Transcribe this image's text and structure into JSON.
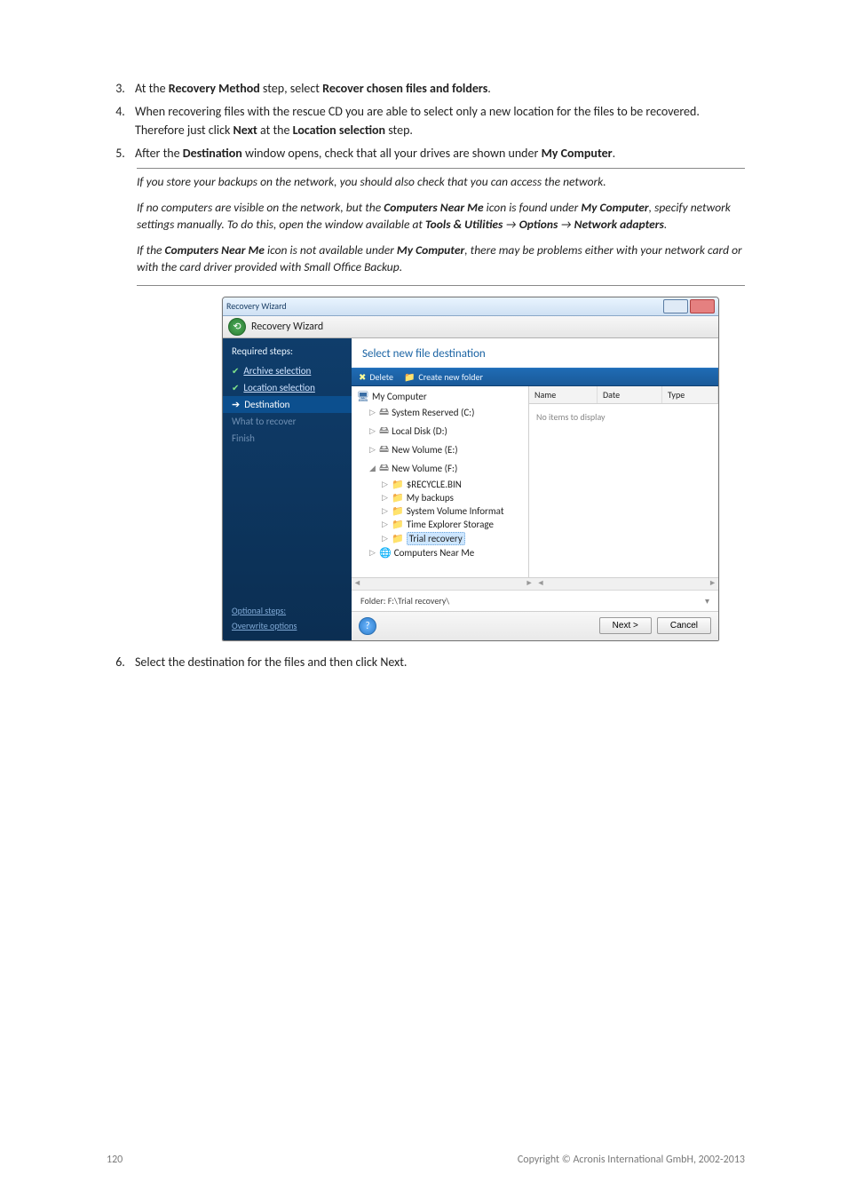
{
  "list": {
    "i3": {
      "pre": "At the ",
      "b1": "Recovery Method",
      "mid": " step, select ",
      "b2": "Recover chosen files and folders",
      "post": "."
    },
    "i4": {
      "pre": "When recovering files with the rescue CD you are able to select only a new location for the files to be recovered. Therefore just click ",
      "b1": "Next",
      "mid": " at the ",
      "b2": "Location selection",
      "post": " step."
    },
    "i5": {
      "pre": "After the ",
      "b1": "Destination",
      "mid": " window opens, check that all your drives are shown under ",
      "b2": "My Computer",
      "post": "."
    },
    "i6": "Select the destination for the files and then click Next."
  },
  "notes": {
    "n1": "If you store your backups on the network, you should also check that you can access the network.",
    "n2": {
      "a": "If no computers are visible on the network, but the ",
      "b1": "Computers Near Me",
      "b": " icon is found under ",
      "b2": "My Computer",
      "c": ", specify network settings manually. To do this, open the window available at ",
      "b3": "Tools & Utilities",
      "arrow1": " → ",
      "b4": "Options",
      "arrow2": " → ",
      "b5": "Network adapters",
      "d": "."
    },
    "n3": {
      "a": "If the ",
      "b1": "Computers Near Me",
      "b": " icon is not available under ",
      "b2": "My Computer",
      "c": ", there may be problems either with your network card or with the card driver provided with Small Office Backup."
    }
  },
  "win": {
    "title": "Recovery Wizard",
    "subbar": "Recovery Wizard",
    "steps_header": "Required steps:",
    "steps": {
      "archive": "Archive selection",
      "location": "Location selection",
      "destination": "Destination",
      "what": "What to recover",
      "finish": "Finish"
    },
    "opt1": "Optional steps:",
    "opt2": "Overwrite options",
    "main_title": "Select new file destination",
    "toolbar": {
      "delete": "Delete",
      "newfolder": "Create new folder"
    },
    "tree": {
      "root": "My Computer",
      "c": "System Reserved (C:)",
      "d": "Local Disk (D:)",
      "e": "New Volume (E:)",
      "f": "New Volume (F:)",
      "recycle": "$RECYCLE.BIN",
      "mybackups": "My backups",
      "svi": "System Volume Informat",
      "tes": "Time Explorer Storage",
      "trial": "Trial recovery",
      "near": "Computers Near Me"
    },
    "list_cols": {
      "name": "Name",
      "date": "Date",
      "type": "Type"
    },
    "list_empty": "No items to display",
    "folder_label": "Folder:",
    "folder_value": "F:\\Trial recovery\\",
    "btn_next": "Next >",
    "btn_cancel": "Cancel"
  },
  "footer": {
    "page": "120",
    "copyright": "Copyright © Acronis International GmbH, 2002-2013"
  }
}
